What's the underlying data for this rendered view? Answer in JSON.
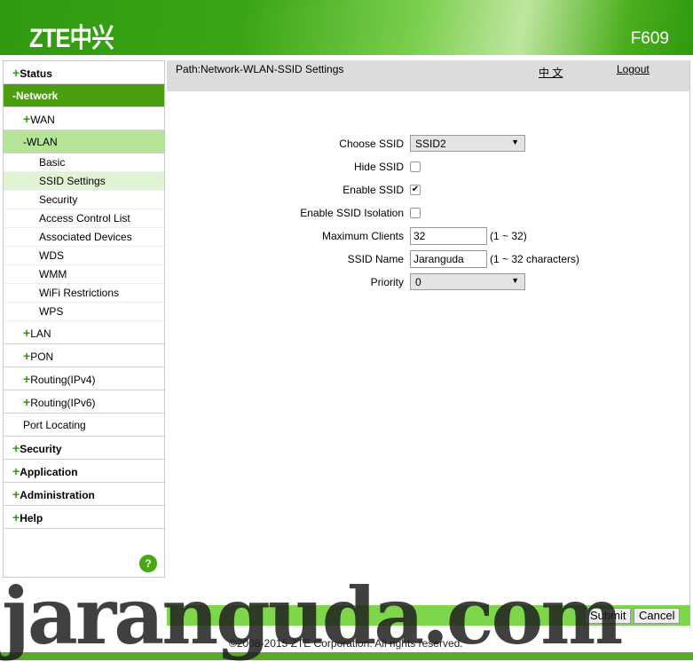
{
  "header": {
    "logo": "ZTE中兴",
    "model": "F609"
  },
  "sidebar": {
    "items": [
      {
        "sign": "+",
        "label": "Status"
      },
      {
        "sign": "-",
        "label": "Network"
      },
      {
        "sign": "+",
        "label": "WAN"
      },
      {
        "sign": "-",
        "label": "WLAN"
      },
      {
        "label": "Basic"
      },
      {
        "label": "SSID Settings"
      },
      {
        "label": "Security"
      },
      {
        "label": "Access Control List"
      },
      {
        "label": "Associated Devices"
      },
      {
        "label": "WDS"
      },
      {
        "label": "WMM"
      },
      {
        "label": "WiFi Restrictions"
      },
      {
        "label": "WPS"
      },
      {
        "sign": "+",
        "label": "LAN"
      },
      {
        "sign": "+",
        "label": "PON"
      },
      {
        "sign": "+",
        "label": "Routing(IPv4)"
      },
      {
        "sign": "+",
        "label": "Routing(IPv6)"
      },
      {
        "label": "Port Locating"
      },
      {
        "sign": "+",
        "label": "Security"
      },
      {
        "sign": "+",
        "label": "Application"
      },
      {
        "sign": "+",
        "label": "Administration"
      },
      {
        "sign": "+",
        "label": "Help"
      }
    ],
    "help": "?"
  },
  "pathbar": {
    "path": "Path:Network-WLAN-SSID Settings",
    "lang": "中 文",
    "logout": "Logout"
  },
  "form": {
    "choose_ssid": {
      "label": "Choose SSID",
      "value": "SSID2"
    },
    "hide_ssid": {
      "label": "Hide SSID",
      "checked": false
    },
    "enable_ssid": {
      "label": "Enable SSID",
      "checked": true,
      "mark": "✔"
    },
    "isolation": {
      "label": "Enable SSID Isolation",
      "checked": false
    },
    "max_clients": {
      "label": "Maximum Clients",
      "value": "32",
      "hint": "(1 ~ 32)"
    },
    "ssid_name": {
      "label": "SSID Name",
      "value": "Jaranguda",
      "hint": "(1 ~ 32 characters)"
    },
    "priority": {
      "label": "Priority",
      "value": "0"
    }
  },
  "buttons": {
    "submit": "Submit",
    "cancel": "Cancel"
  },
  "footer": {
    "copyright": "©2008-2015 ZTE Corporation. All rights reserved."
  },
  "watermark": "jaranguda.com",
  "colors": {
    "brand_green": "#3aa514",
    "menu_selected": "#4a9e10",
    "submenu_selected": "#b5e496"
  }
}
